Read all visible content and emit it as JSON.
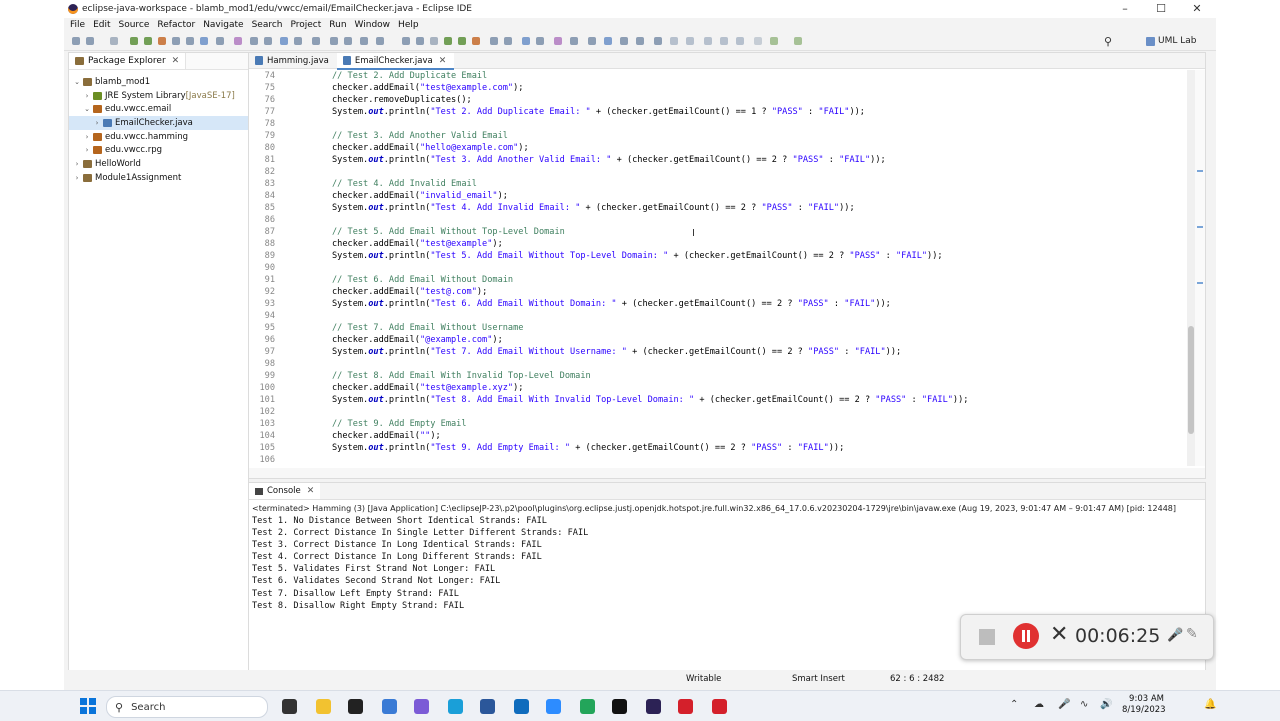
{
  "window": {
    "title": "eclipse-java-workspace - blamb_mod1/edu/vwcc/email/EmailChecker.java - Eclipse IDE",
    "controls": [
      "–",
      "☐",
      "✕"
    ]
  },
  "menu": [
    "File",
    "Edit",
    "Source",
    "Refactor",
    "Navigate",
    "Search",
    "Project",
    "Run",
    "Window",
    "Help"
  ],
  "toolbar": {
    "perspective_label": "UML Lab"
  },
  "package_explorer": {
    "tab_label": "Package Explorer",
    "items": [
      {
        "label": "blamb_mod1",
        "extra": "",
        "depth": 0,
        "expanded": "⌄",
        "icon_color": "#8a6d3b",
        "selected": false
      },
      {
        "label": "JRE System Library ",
        "extra": "[JavaSE-17]",
        "depth": 1,
        "expanded": "›",
        "icon_color": "#6b8e23",
        "selected": false
      },
      {
        "label": "edu.vwcc.email",
        "extra": "",
        "depth": 1,
        "expanded": "⌄",
        "icon_color": "#b5651d",
        "selected": false
      },
      {
        "label": "EmailChecker.java",
        "extra": "",
        "depth": 2,
        "expanded": "›",
        "icon_color": "#4a7ab5",
        "selected": true
      },
      {
        "label": "edu.vwcc.hamming",
        "extra": "",
        "depth": 1,
        "expanded": "›",
        "icon_color": "#b5651d",
        "selected": false
      },
      {
        "label": "edu.vwcc.rpg",
        "extra": "",
        "depth": 1,
        "expanded": "›",
        "icon_color": "#b5651d",
        "selected": false
      },
      {
        "label": "HelloWorld",
        "extra": "",
        "depth": 0,
        "expanded": "›",
        "icon_color": "#8a6d3b",
        "selected": false
      },
      {
        "label": "Module1Assignment",
        "extra": "",
        "depth": 0,
        "expanded": "›",
        "icon_color": "#8a6d3b",
        "selected": false
      }
    ]
  },
  "editor": {
    "tabs": [
      {
        "label": "Hamming.java",
        "active": false
      },
      {
        "label": "EmailChecker.java",
        "active": true
      }
    ],
    "lines": [
      {
        "n": "74",
        "segs": [
          [
            "c",
            "// Test 2. Add Duplicate Email"
          ]
        ]
      },
      {
        "n": "75",
        "segs": [
          [
            "p",
            "checker.addEmail("
          ],
          [
            "s",
            "\"test@example.com\""
          ],
          [
            "p",
            ");"
          ]
        ]
      },
      {
        "n": "76",
        "segs": [
          [
            "p",
            "checker.removeDuplicates();"
          ]
        ]
      },
      {
        "n": "77",
        "segs": [
          [
            "p",
            "System."
          ],
          [
            "f",
            "out"
          ],
          [
            "p",
            ".println("
          ],
          [
            "s",
            "\"Test 2. Add Duplicate Email: \""
          ],
          [
            "p",
            " + (checker.getEmailCount() == 1 ? "
          ],
          [
            "s",
            "\"PASS\""
          ],
          [
            "p",
            " : "
          ],
          [
            "s",
            "\"FAIL\""
          ],
          [
            "p",
            "));"
          ]
        ]
      },
      {
        "n": "78",
        "segs": []
      },
      {
        "n": "79",
        "segs": [
          [
            "c",
            "// Test 3. Add Another Valid Email"
          ]
        ]
      },
      {
        "n": "80",
        "segs": [
          [
            "p",
            "checker.addEmail("
          ],
          [
            "s",
            "\"hello@example.com\""
          ],
          [
            "p",
            ");"
          ]
        ]
      },
      {
        "n": "81",
        "segs": [
          [
            "p",
            "System."
          ],
          [
            "f",
            "out"
          ],
          [
            "p",
            ".println("
          ],
          [
            "s",
            "\"Test 3. Add Another Valid Email: \""
          ],
          [
            "p",
            " + (checker.getEmailCount() == 2 ? "
          ],
          [
            "s",
            "\"PASS\""
          ],
          [
            "p",
            " : "
          ],
          [
            "s",
            "\"FAIL\""
          ],
          [
            "p",
            "));"
          ]
        ]
      },
      {
        "n": "82",
        "segs": []
      },
      {
        "n": "83",
        "segs": [
          [
            "c",
            "// Test 4. Add Invalid Email"
          ]
        ]
      },
      {
        "n": "84",
        "segs": [
          [
            "p",
            "checker.addEmail("
          ],
          [
            "s",
            "\"invalid_email\""
          ],
          [
            "p",
            ");"
          ]
        ]
      },
      {
        "n": "85",
        "segs": [
          [
            "p",
            "System."
          ],
          [
            "f",
            "out"
          ],
          [
            "p",
            ".println("
          ],
          [
            "s",
            "\"Test 4. Add Invalid Email: \""
          ],
          [
            "p",
            " + (checker.getEmailCount() == 2 ? "
          ],
          [
            "s",
            "\"PASS\""
          ],
          [
            "p",
            " : "
          ],
          [
            "s",
            "\"FAIL\""
          ],
          [
            "p",
            "));"
          ]
        ]
      },
      {
        "n": "86",
        "segs": []
      },
      {
        "n": "87",
        "segs": [
          [
            "c",
            "// Test 5. Add Email Without Top-Level Domain"
          ]
        ]
      },
      {
        "n": "88",
        "segs": [
          [
            "p",
            "checker.addEmail("
          ],
          [
            "s",
            "\"test@example\""
          ],
          [
            "p",
            ");"
          ]
        ]
      },
      {
        "n": "89",
        "segs": [
          [
            "p",
            "System."
          ],
          [
            "f",
            "out"
          ],
          [
            "p",
            ".println("
          ],
          [
            "s",
            "\"Test 5. Add Email Without Top-Level Domain: \""
          ],
          [
            "p",
            " + (checker.getEmailCount() == 2 ? "
          ],
          [
            "s",
            "\"PASS\""
          ],
          [
            "p",
            " : "
          ],
          [
            "s",
            "\"FAIL\""
          ],
          [
            "p",
            "));"
          ]
        ]
      },
      {
        "n": "90",
        "segs": []
      },
      {
        "n": "91",
        "segs": [
          [
            "c",
            "// Test 6. Add Email Without Domain"
          ]
        ]
      },
      {
        "n": "92",
        "segs": [
          [
            "p",
            "checker.addEmail("
          ],
          [
            "s",
            "\"test@.com\""
          ],
          [
            "p",
            ");"
          ]
        ]
      },
      {
        "n": "93",
        "segs": [
          [
            "p",
            "System."
          ],
          [
            "f",
            "out"
          ],
          [
            "p",
            ".println("
          ],
          [
            "s",
            "\"Test 6. Add Email Without Domain: \""
          ],
          [
            "p",
            " + (checker.getEmailCount() == 2 ? "
          ],
          [
            "s",
            "\"PASS\""
          ],
          [
            "p",
            " : "
          ],
          [
            "s",
            "\"FAIL\""
          ],
          [
            "p",
            "));"
          ]
        ]
      },
      {
        "n": "94",
        "segs": []
      },
      {
        "n": "95",
        "segs": [
          [
            "c",
            "// Test 7. Add Email Without Username"
          ]
        ]
      },
      {
        "n": "96",
        "segs": [
          [
            "p",
            "checker.addEmail("
          ],
          [
            "s",
            "\"@example.com\""
          ],
          [
            "p",
            ");"
          ]
        ]
      },
      {
        "n": "97",
        "segs": [
          [
            "p",
            "System."
          ],
          [
            "f",
            "out"
          ],
          [
            "p",
            ".println("
          ],
          [
            "s",
            "\"Test 7. Add Email Without Username: \""
          ],
          [
            "p",
            " + (checker.getEmailCount() == 2 ? "
          ],
          [
            "s",
            "\"PASS\""
          ],
          [
            "p",
            " : "
          ],
          [
            "s",
            "\"FAIL\""
          ],
          [
            "p",
            "));"
          ]
        ]
      },
      {
        "n": "98",
        "segs": []
      },
      {
        "n": "99",
        "segs": [
          [
            "c",
            "// Test 8. Add Email With Invalid Top-Level Domain"
          ]
        ]
      },
      {
        "n": "100",
        "segs": [
          [
            "p",
            "checker.addEmail("
          ],
          [
            "s",
            "\"test@example.xyz\""
          ],
          [
            "p",
            ");"
          ]
        ]
      },
      {
        "n": "101",
        "segs": [
          [
            "p",
            "System."
          ],
          [
            "f",
            "out"
          ],
          [
            "p",
            ".println("
          ],
          [
            "s",
            "\"Test 8. Add Email With Invalid Top-Level Domain: \""
          ],
          [
            "p",
            " + (checker.getEmailCount() == 2 ? "
          ],
          [
            "s",
            "\"PASS\""
          ],
          [
            "p",
            " : "
          ],
          [
            "s",
            "\"FAIL\""
          ],
          [
            "p",
            "));"
          ]
        ]
      },
      {
        "n": "102",
        "segs": []
      },
      {
        "n": "103",
        "segs": [
          [
            "c",
            "// Test 9. Add Empty Email"
          ]
        ]
      },
      {
        "n": "104",
        "segs": [
          [
            "p",
            "checker.addEmail("
          ],
          [
            "s",
            "\"\""
          ],
          [
            "p",
            ");"
          ]
        ]
      },
      {
        "n": "105",
        "segs": [
          [
            "p",
            "System."
          ],
          [
            "f",
            "out"
          ],
          [
            "p",
            ".println("
          ],
          [
            "s",
            "\"Test 9. Add Empty Email: \""
          ],
          [
            "p",
            " + (checker.getEmailCount() == 2 ? "
          ],
          [
            "s",
            "\"PASS\""
          ],
          [
            "p",
            " : "
          ],
          [
            "s",
            "\"FAIL\""
          ],
          [
            "p",
            "));"
          ]
        ]
      },
      {
        "n": "106",
        "segs": []
      }
    ]
  },
  "console": {
    "tab_label": "Console",
    "status": "<terminated> Hamming (3) [Java Application] C:\\eclipseJP-23\\.p2\\pool\\plugins\\org.eclipse.justj.openjdk.hotspot.jre.full.win32.x86_64_17.0.6.v20230204-1729\\jre\\bin\\javaw.exe  (Aug 19, 2023, 9:01:47 AM – 9:01:47 AM) [pid: 12448]",
    "output": [
      "Test 1. No Distance Between Short Identical Strands: FAIL",
      "Test 2. Correct Distance In Single Letter Different Strands: FAIL",
      "Test 3. Correct Distance In Long Identical Strands: FAIL",
      "Test 4. Correct Distance In Long Different Strands: FAIL",
      "Test 5. Validates First Strand Not Longer: FAIL",
      "Test 6. Validates Second Strand Not Longer: FAIL",
      "Test 7. Disallow Left Empty Strand: FAIL",
      "Test 8. Disallow Right Empty Strand: FAIL"
    ]
  },
  "statusbar": {
    "writable": "Writable",
    "insert_mode": "Smart Insert",
    "position": "62 : 6 : 2482"
  },
  "recorder": {
    "time": "00:06:25"
  },
  "taskbar": {
    "search_label": "Search",
    "time": "9:03 AM",
    "date": "8/19/2023"
  }
}
